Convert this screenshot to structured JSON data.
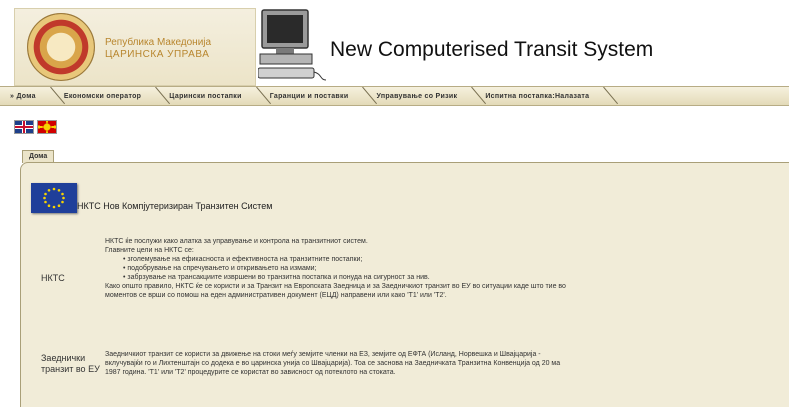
{
  "header": {
    "org_line1": "Република Македонија",
    "org_line2": "ЦАРИНСКА УПРАВА",
    "system_title": "New Computerised Transit System"
  },
  "nav": {
    "items": [
      "» Дома",
      "Економски оператор",
      "Царински постапки",
      "Гаранции и поставки",
      "Управување со Ризик",
      "Испитна постапка:Налазата"
    ]
  },
  "flags": [
    "flag-uk-icon",
    "flag-mk-icon"
  ],
  "panel": {
    "tab_label": "Дома",
    "title": "НКТС Нов Компјутеризиран Транзитен Систем",
    "rows": [
      {
        "label": "НКТС",
        "lines": [
          "НКТС ќе послужи како алатка за управување и контрола на транзитниот систем.",
          "Главните цели на НКТС се:",
          "• зголемување на ефикасноста и ефективноста на транзитните постапки;",
          "• подобрување на спречувањето и откривањето на измами;",
          "• забрзување на трансакциите извршени во транзитна постапка и понуда на сигурност за нив.",
          "Како општо правило, НКТС ќе се користи и за Транзит на Европската Заедница и за Заедничкиот транзит во ЕУ во ситуации каде што тие во",
          "моментов се врши со помош на еден административен документ (ЕЦД) направени или како 'Т1' или 'Т2'."
        ]
      },
      {
        "label": "Заеднички транзит во ЕУ",
        "lines": [
          "Заедничкиот транзит се користи за движење на стоки меѓу земјите членки на ЕЗ, земјите од ЕФТА (Исланд, Норвешка и Швајцарија -",
          "вклучувајќи го и Лихтенштајн со додека е во царинска унија со Швајцарија). Тоа се заснова на Заедничката Транзитна Конвенција од 20 ма",
          "1987 година. 'Т1' или 'Т2' процедурите се користат во зависност од потеклото на стоката."
        ]
      }
    ]
  }
}
